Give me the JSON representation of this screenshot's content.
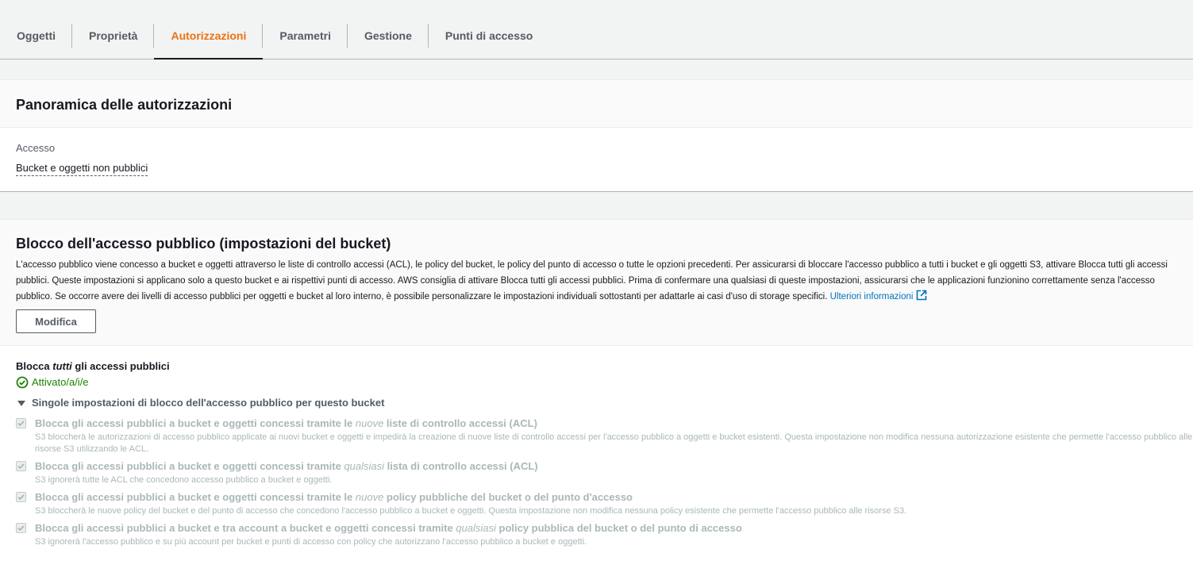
{
  "tabs": [
    {
      "label": "Oggetti"
    },
    {
      "label": "Proprietà"
    },
    {
      "label": "Autorizzazioni"
    },
    {
      "label": "Parametri"
    },
    {
      "label": "Gestione"
    },
    {
      "label": "Punti di accesso"
    }
  ],
  "active_tab": "Autorizzazioni",
  "overview": {
    "title": "Panoramica delle autorizzazioni",
    "access_label": "Accesso",
    "access_value": "Bucket e oggetti non pubblici"
  },
  "block_public": {
    "title": "Blocco dell'accesso pubblico (impostazioni del bucket)",
    "description": "L'accesso pubblico viene concesso a bucket e oggetti attraverso le liste di controllo accessi (ACL), le policy del bucket, le policy del punto di accesso o tutte le opzioni precedenti. Per assicurarsi di bloccare l'accesso pubblico a tutti i bucket e gli oggetti S3, attivare Blocca tutti gli accessi pubblici. Queste impostazioni si applicano solo a questo bucket e ai rispettivi punti di accesso. AWS consiglia di attivare Blocca tutti gli accessi pubblici. Prima di confermare una qualsiasi di queste impostazioni, assicurarsi che le applicazioni funzionino correttamente senza l'accesso pubblico. Se occorre avere dei livelli di accesso pubblici per oggetti e bucket al loro interno, è possibile personalizzare le impostazioni individuali sottostanti per adattarle ai casi d'uso di storage specifici.",
    "learn_more": "Ulteriori informazioni",
    "edit_button": "Modifica",
    "block_all_prefix": "Blocca ",
    "block_all_em": "tutti",
    "block_all_suffix": " gli accessi pubblici",
    "status": "Attivato/a/i/e",
    "expander": "Singole impostazioni di blocco dell'accesso pubblico per questo bucket",
    "options": [
      {
        "title_prefix": "Blocca gli accessi pubblici a bucket e oggetti concessi tramite le ",
        "title_em": "nuove",
        "title_suffix": " liste di controllo accessi (ACL)",
        "description": "S3 bloccherà le autorizzazioni di accesso pubblico applicate ai nuovi bucket e oggetti e impedirà la creazione di nuove liste di controllo accessi per l'accesso pubblico a oggetti e bucket esistenti. Questa impostazione non modifica nessuna autorizzazione esistente che permette l'accesso pubblico alle risorse S3 utilizzando le ACL.",
        "checked": true
      },
      {
        "title_prefix": "Blocca gli accessi pubblici a bucket e oggetti concessi tramite ",
        "title_em": "qualsiasi",
        "title_suffix": " lista di controllo accessi (ACL)",
        "description": "S3 ignorerà tutte le ACL che concedono accesso pubblico a bucket e oggetti.",
        "checked": true
      },
      {
        "title_prefix": "Blocca gli accessi pubblici a bucket e oggetti concessi tramite le ",
        "title_em": "nuove",
        "title_suffix": " policy pubbliche del bucket o del punto d'accesso",
        "description": "S3 bloccherà le nuove policy del bucket e del punto di accesso che concedono l'accesso pubblico a bucket e oggetti. Questa impostazione non modifica nessuna policy esistente che permette l'accesso pubblico alle risorse S3.",
        "checked": true
      },
      {
        "title_prefix": "Blocca gli accessi pubblici a bucket e tra account a bucket e oggetti concessi tramite ",
        "title_em": "qualsiasi",
        "title_suffix": " policy pubblica del bucket o del punto di accesso",
        "description": "S3 ignorerà l'accesso pubblico e su più account per bucket e punti di accesso con policy che autorizzano l'accesso pubblico a bucket e oggetti.",
        "checked": true
      }
    ]
  },
  "colors": {
    "accent": "#ec7211",
    "success": "#1d8102",
    "link": "#0073bb"
  },
  "icons": [
    "external-link-icon",
    "check-circle-icon",
    "caret-down-icon",
    "checkbox-check-icon"
  ]
}
